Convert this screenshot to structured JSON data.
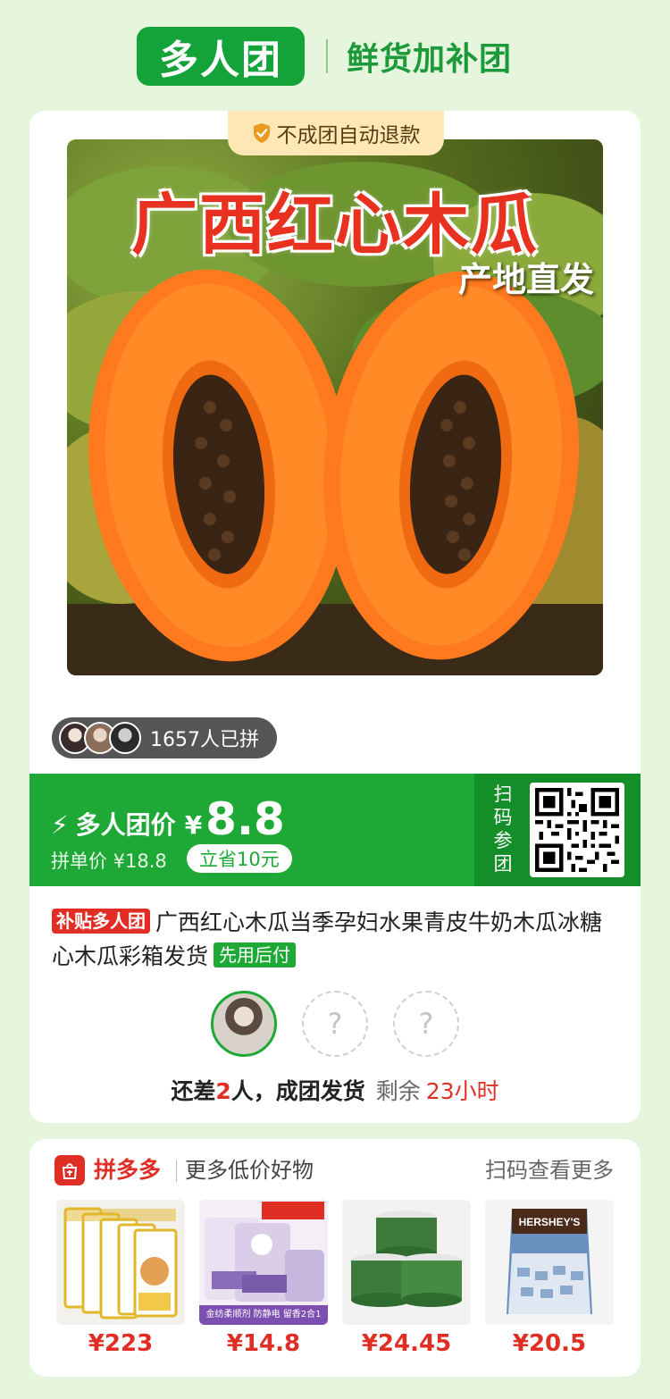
{
  "header": {
    "brand": "多人团",
    "subtitle": "鲜货加补团"
  },
  "product": {
    "refund_tag": "不成团自动退款",
    "image_title": "广西红心木瓜",
    "image_subtitle": "产地直发",
    "buyers_count": "1657人已拼",
    "group_price_label": "多人团价",
    "currency": "¥",
    "group_price": "8.8",
    "original_price": "拼单价 ¥18.8",
    "save_badge": "立省10元",
    "scan_join": "扫码参团",
    "subsidy_badge": "补贴多人团",
    "title": "广西红心木瓜当季孕妇水果青皮牛奶木瓜冰糖心木瓜彩箱发货",
    "pay_later_badge": "先用后付",
    "status_prefix": "还差",
    "status_count": "2",
    "status_suffix": "人，成团发货",
    "remain_label": "剩余",
    "remain_time": "23小时",
    "empty_slot_mark": "?"
  },
  "more": {
    "platform": "拼多多",
    "slogan": "更多低价好物",
    "scan_more": "扫码查看更多",
    "goods": [
      {
        "price": "¥223",
        "icon": "cat-food-bags"
      },
      {
        "price": "¥14.8",
        "icon": "comfort-softener",
        "banner": "金纺柔顺剂 防静电 留香2合1"
      },
      {
        "price": "¥24.45",
        "icon": "green-tea-jars"
      },
      {
        "price": "¥20.5",
        "icon": "hersheys-bag",
        "label": "HERSHEY'S"
      }
    ]
  },
  "colors": {
    "brand_green": "#1ea936",
    "accent_red": "#e02e24",
    "background": "#e6f6dc"
  }
}
